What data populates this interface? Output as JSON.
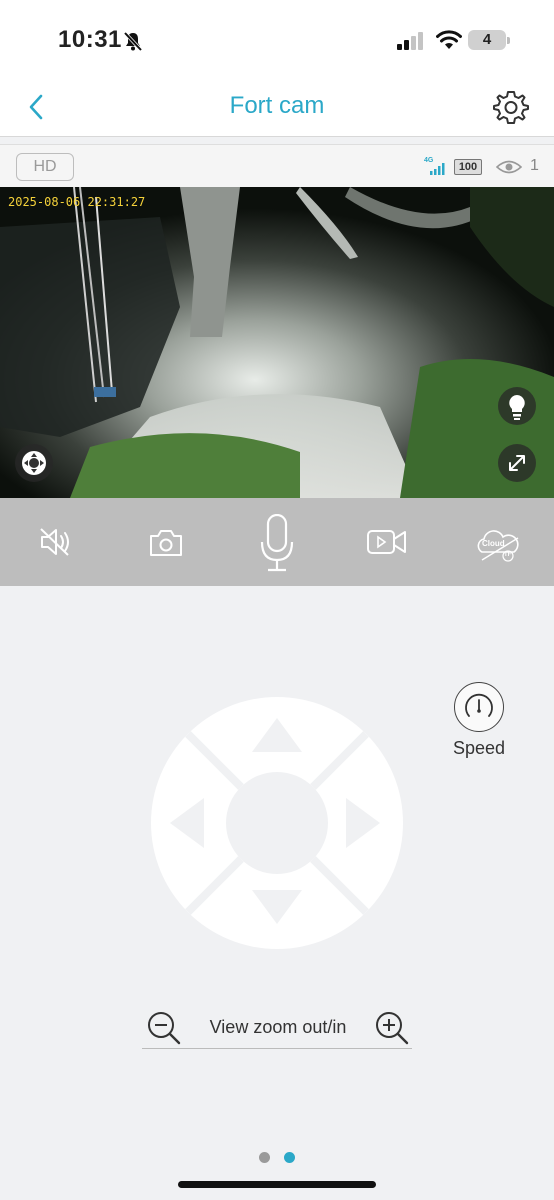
{
  "status_bar": {
    "time": "10:31",
    "battery_level": "4"
  },
  "header": {
    "title": "Fort cam"
  },
  "camera_info": {
    "quality_label": "HD",
    "network_label": "4G",
    "battery_label": "100",
    "viewer_count": "1"
  },
  "video": {
    "timestamp": "2025-08-06 22:31:27"
  },
  "controls": [
    "mute-toggle",
    "snapshot",
    "talk-microphone",
    "record-video",
    "cloud-storage"
  ],
  "cloud": {
    "badge": "Cloud",
    "sub_badge": "TF"
  },
  "speed": {
    "label": "Speed"
  },
  "zoom": {
    "label": "View zoom out/in"
  },
  "pager": {
    "pages": 2,
    "active_index": 1
  },
  "colors": {
    "accent": "#2ba8c8",
    "control_bar": "#bdbdbd",
    "background": "#f0f1f3"
  }
}
